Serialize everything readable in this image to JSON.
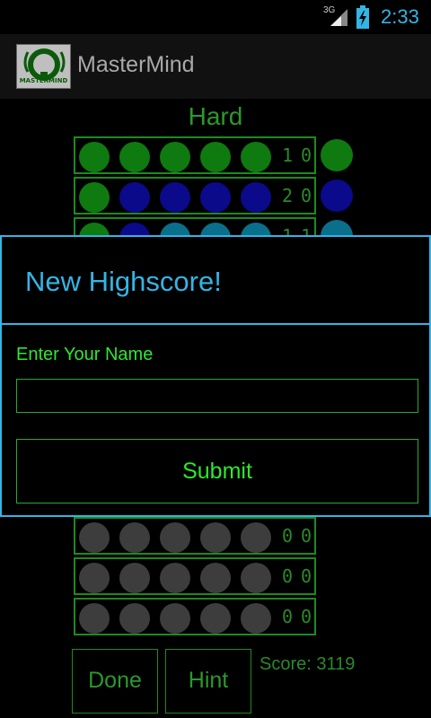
{
  "status_bar": {
    "network": "3G",
    "time": "2:33"
  },
  "action_bar": {
    "app_name": "MasterMind",
    "app_icon_text": "MASTERMIND"
  },
  "game": {
    "difficulty": "Hard",
    "rows": [
      {
        "pegs": [
          "#0f7a0f",
          "#0f7a0f",
          "#0f7a0f",
          "#0f7a0f",
          "#0f7a0f"
        ],
        "black": "1",
        "white": "0",
        "secret": "#0f7a0f"
      },
      {
        "pegs": [
          "#0f7a0f",
          "#0a0a8a",
          "#0a0a8a",
          "#0a0a8a",
          "#0a0a8a"
        ],
        "black": "2",
        "white": "0",
        "secret": "#0a0a8a"
      },
      {
        "pegs": [
          "#0f7a0f",
          "#0a0a8a",
          "#0a6f8a",
          "#0a6f8a",
          "#0a6f8a"
        ],
        "black": "1",
        "white": "1",
        "secret": "#0a6f8a"
      },
      {
        "pegs": [
          "#3d3d3d",
          "#3d3d3d",
          "#3d3d3d",
          "#3d3d3d",
          "#3d3d3d"
        ],
        "black": "0",
        "white": "0"
      },
      {
        "pegs": [
          "#3d3d3d",
          "#3d3d3d",
          "#3d3d3d",
          "#3d3d3d",
          "#3d3d3d"
        ],
        "black": "0",
        "white": "0"
      },
      {
        "pegs": [
          "#3d3d3d",
          "#3d3d3d",
          "#3d3d3d",
          "#3d3d3d",
          "#3d3d3d"
        ],
        "black": "0",
        "white": "0"
      }
    ],
    "done_label": "Done",
    "hint_label": "Hint",
    "score_text": "Score: 3119"
  },
  "dialog": {
    "title": "New Highscore!",
    "prompt": "Enter Your Name",
    "name_value": "",
    "submit_label": "Submit"
  },
  "colors": {
    "accent": "#33b5e5",
    "green": "#2ee82e",
    "border_green": "#1e8a1e"
  }
}
